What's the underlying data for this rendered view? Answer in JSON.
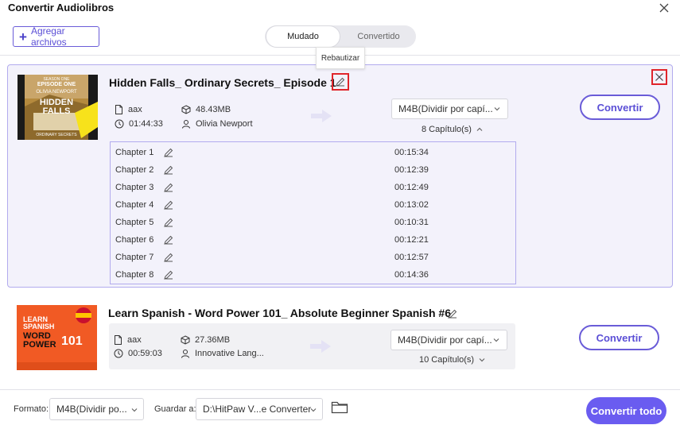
{
  "window": {
    "title": "Convertir Audiolibros"
  },
  "toolbar": {
    "add_files_label": "Agregar archivos"
  },
  "tabs": [
    {
      "label": "Mudado",
      "active": true
    },
    {
      "label": "Convertido",
      "active": false
    }
  ],
  "tooltip": {
    "text": "Rebautizar"
  },
  "items": [
    {
      "title": "Hidden Falls_ Ordinary Secrets_ Episode 1",
      "cover": {
        "line1": "SEASON ONE",
        "line2": "EPISODE ONE",
        "author": "OLIVIA NEWPORT",
        "title": "HIDDEN FALLS",
        "subtitle": "ORDINARY SECRETS"
      },
      "format": "aax",
      "size": "48.43MB",
      "duration": "01:44:33",
      "author": "Olivia Newport",
      "output_format": "M4B(Dividir por capí...",
      "chapters_count": "8 Capítulo(s)",
      "expanded": true,
      "chapters": [
        {
          "name": "Chapter 1",
          "duration": "00:15:34"
        },
        {
          "name": "Chapter 2",
          "duration": "00:12:39"
        },
        {
          "name": "Chapter 3",
          "duration": "00:12:49"
        },
        {
          "name": "Chapter 4",
          "duration": "00:13:02"
        },
        {
          "name": "Chapter 5",
          "duration": "00:10:31"
        },
        {
          "name": "Chapter 6",
          "duration": "00:12:21"
        },
        {
          "name": "Chapter 7",
          "duration": "00:12:57"
        },
        {
          "name": "Chapter 8",
          "duration": "00:14:36"
        }
      ],
      "convert_label": "Convertir"
    },
    {
      "title": "Learn Spanish - Word Power 101_ Absolute Beginner Spanish #6",
      "cover": {
        "line1": "LEARN",
        "line2": "SPANISH",
        "line3": "WORD",
        "line4": "POWER",
        "number": "101"
      },
      "format": "aax",
      "size": "27.36MB",
      "duration": "00:59:03",
      "author": "Innovative Lang...",
      "output_format": "M4B(Dividir por capí...",
      "chapters_count": "10 Capítulo(s)",
      "expanded": false,
      "convert_label": "Convertir"
    }
  ],
  "bottom": {
    "format_label": "Formato:",
    "format_value": "M4B(Dividir po...",
    "save_label": "Guardar a:",
    "save_value": "D:\\HitPaw V...e Converter",
    "convert_all_label": "Convertir todo"
  },
  "colors": {
    "accent": "#6a5cd8",
    "convert_all_bg": "#6a5cf0",
    "card_bg": "#f3f2fb",
    "highlight_red": "#e0252b"
  }
}
